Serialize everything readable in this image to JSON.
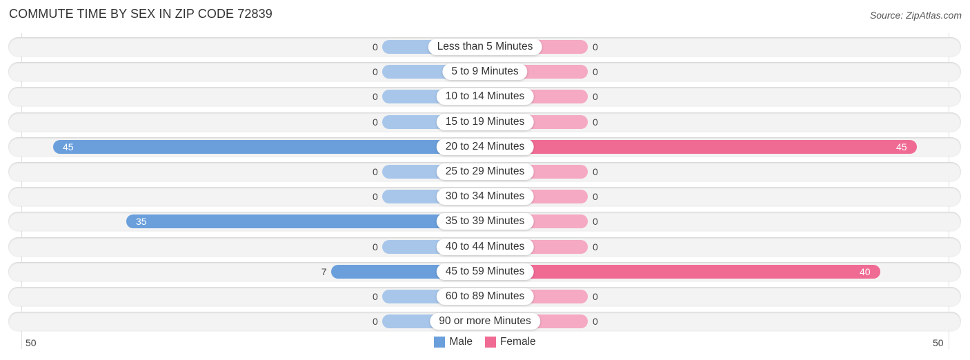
{
  "title": "COMMUTE TIME BY SEX IN ZIP CODE 72839",
  "source": "Source: ZipAtlas.com",
  "colors": {
    "male": "#6a9fdc",
    "male_low": "#a8c6ea",
    "female": "#f06b94",
    "female_low": "#f5a9c2"
  },
  "axis": {
    "left_tick": "50",
    "right_tick": "50"
  },
  "legend": [
    {
      "label": "Male",
      "color": "#6a9fdc"
    },
    {
      "label": "Female",
      "color": "#f06b94"
    }
  ],
  "chart_data": {
    "type": "bar",
    "orientation": "horizontal-diverging",
    "title": "COMMUTE TIME BY SEX IN ZIP CODE 72839",
    "categories": [
      "Less than 5 Minutes",
      "5 to 9 Minutes",
      "10 to 14 Minutes",
      "15 to 19 Minutes",
      "20 to 24 Minutes",
      "25 to 29 Minutes",
      "30 to 34 Minutes",
      "35 to 39 Minutes",
      "40 to 44 Minutes",
      "45 to 59 Minutes",
      "60 to 89 Minutes",
      "90 or more Minutes"
    ],
    "series": [
      {
        "name": "Male",
        "values": [
          0,
          0,
          0,
          0,
          45,
          0,
          0,
          35,
          0,
          7,
          0,
          0
        ]
      },
      {
        "name": "Female",
        "values": [
          0,
          0,
          0,
          0,
          45,
          0,
          0,
          0,
          0,
          40,
          0,
          0
        ]
      }
    ],
    "xlim": [
      -50,
      50
    ],
    "tick_labels": [
      "50",
      "50"
    ],
    "legend_position": "bottom-center",
    "grid": false
  }
}
